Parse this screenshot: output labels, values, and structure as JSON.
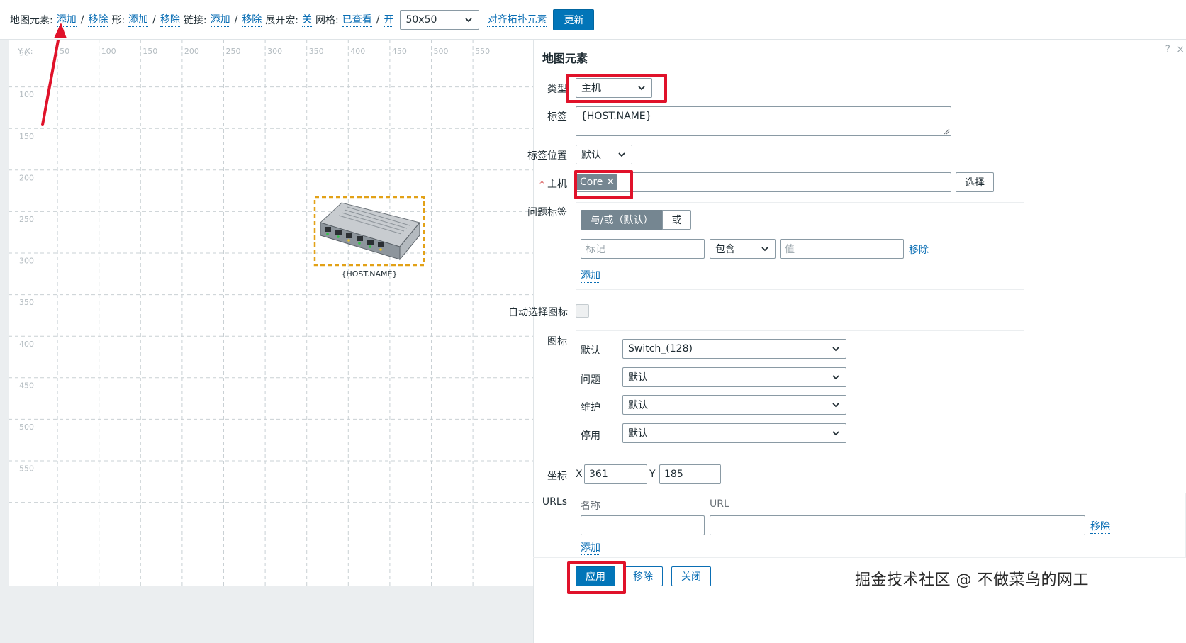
{
  "toolbar": {
    "map_element_label": "地图元素:",
    "shape_label": "形:",
    "link_label": "链接:",
    "expand_macro_label": "展开宏:",
    "grid_label": "网格:",
    "add": "添加",
    "remove": "移除",
    "slash": "/",
    "macro_off": "关",
    "grid_shown": "已查看",
    "grid_on": "开",
    "grid_size": "50x50",
    "align_label": "对齐拓扑元素",
    "update_button": "更新"
  },
  "canvas": {
    "corner_label": "Y X:",
    "x_ticks": [
      "50",
      "100",
      "150",
      "200",
      "250",
      "300",
      "350",
      "400",
      "450",
      "500",
      "550"
    ],
    "y_ticks": [
      "50",
      "100",
      "150",
      "200",
      "250",
      "300",
      "350",
      "400",
      "450",
      "500",
      "550"
    ],
    "host_label": "{HOST.NAME}"
  },
  "dialog": {
    "title": "地图元素",
    "help": "?",
    "close": "×",
    "type_label": "类型",
    "type_value": "主机",
    "label_label": "标签",
    "label_value": "{HOST.NAME}",
    "label_position_label": "标签位置",
    "label_position_value": "默认",
    "host_label": "主机",
    "host_chip": "Core",
    "select_button": "选择",
    "problem_tags_label": "问题标签",
    "andor_option": "与/或（默认）",
    "or_option": "或",
    "tag_placeholder": "标记",
    "operator_value": "包含",
    "value_placeholder": "值",
    "remove_link": "移除",
    "add_link": "添加",
    "auto_icon_label": "自动选择图标",
    "icons_label": "图标",
    "icon_default_label": "默认",
    "icon_default_value": "Switch_(128)",
    "icon_problem_label": "问题",
    "icon_problem_value": "默认",
    "icon_maintenance_label": "维护",
    "icon_maintenance_value": "默认",
    "icon_disabled_label": "停用",
    "icon_disabled_value": "默认",
    "coords_label": "坐标",
    "x_label": "X",
    "x_value": "361",
    "y_label": "Y",
    "y_value": "185",
    "urls_label": "URLs",
    "url_name_header": "名称",
    "url_header": "URL",
    "url_remove_link": "移除",
    "url_add_link": "添加",
    "apply_button": "应用",
    "remove_button": "移除",
    "close_button": "关闭"
  },
  "watermark": "掘金技术社区 @ 不做菜鸟的网工",
  "colors": {
    "primary": "#0275b8",
    "link": "#0a6eb4",
    "highlight_red": "#e0122a",
    "selection_orange": "#e2a117"
  }
}
